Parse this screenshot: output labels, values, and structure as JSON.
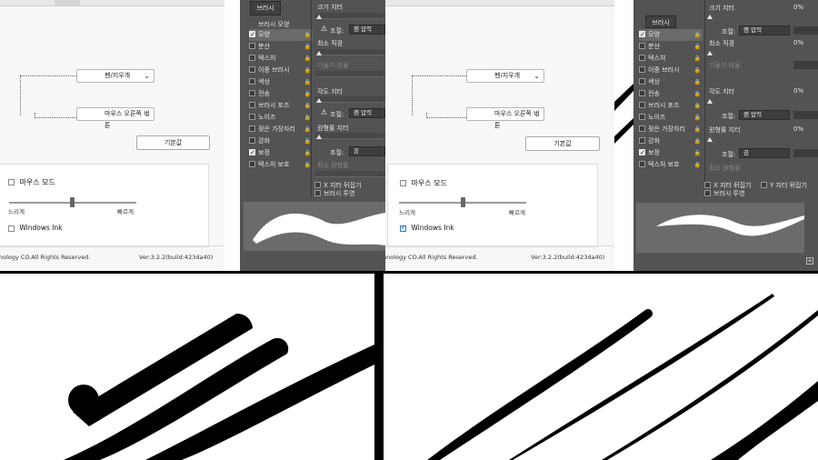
{
  "left_driver": {
    "dropdown_top": "펜/지우개",
    "dropdown_bottom": "마우스 오른쪽 버튼",
    "default_button": "기본값",
    "mouse_mode_label": "마우스 모드",
    "slow_label": "느리게",
    "fast_label": "빠르게",
    "windows_ink_label": "Windows Ink",
    "windows_ink_checked": false,
    "copyright": "nology CO.All Rights Reserved.",
    "version": "Ver:3.2.2(build:423da40)"
  },
  "right_driver": {
    "dropdown_top": "펜/지우개",
    "dropdown_bottom": "마우스 오른쪽 버튼",
    "default_button": "기본값",
    "mouse_mode_label": "마우스 모드",
    "slow_label": "느리게",
    "fast_label": "빠르게",
    "windows_ink_label": "Windows Ink",
    "windows_ink_checked": true,
    "copyright": "nnology CO.All Rights Reserved.",
    "version": "Ver:3.2.2(build:423da40)"
  },
  "brush_panel": {
    "tab_label": "브러시",
    "header": "브러시 모양",
    "items": [
      {
        "label": "모양",
        "checked": true,
        "selected": true
      },
      {
        "label": "분산",
        "checked": false,
        "selected": false
      },
      {
        "label": "텍스처",
        "checked": false,
        "selected": false
      },
      {
        "label": "이중 브러시",
        "checked": false,
        "selected": false
      },
      {
        "label": "색상",
        "checked": false,
        "selected": false
      },
      {
        "label": "전송",
        "checked": false,
        "selected": false
      },
      {
        "label": "브러시 포즈",
        "checked": false,
        "selected": false
      },
      {
        "label": "노이즈",
        "checked": false,
        "selected": false
      },
      {
        "label": "젖은 가장자리",
        "checked": false,
        "selected": false
      },
      {
        "label": "강화",
        "checked": false,
        "selected": false
      },
      {
        "label": "보정",
        "checked": true,
        "selected": false
      },
      {
        "label": "텍스처 보호",
        "checked": false,
        "selected": false
      }
    ],
    "size_jitter": "크기 지터",
    "control_label": "조절:",
    "pen_pressure": "펜 압력",
    "min_diameter": "최소 직경",
    "tilt_scale": "기울기 비율",
    "angle_jitter": "각도 지터",
    "roundness_jitter": "원형률 지터",
    "off": "끔",
    "min_roundness": "최소 원형률",
    "flip_x": "X 지터 뒤집기",
    "flip_y": "Y 지터 뒤집기",
    "brush_projection": "브러시 투영",
    "zero_percent": "0%",
    "lock_glyph": "🔒",
    "warn_glyph": "⚠"
  }
}
